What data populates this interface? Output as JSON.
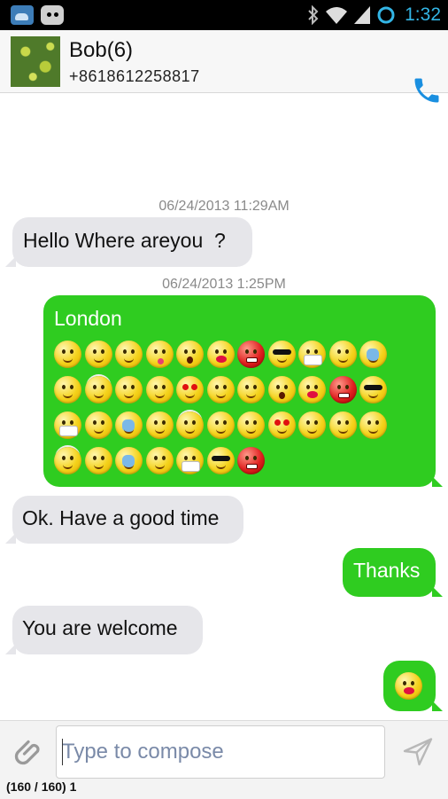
{
  "status_bar": {
    "time": "1:32",
    "icons": [
      "weather-notification-icon",
      "cyanogen-notification-icon",
      "bluetooth-icon",
      "wifi-icon",
      "signal-icon",
      "sync-icon"
    ],
    "time_color": "#33b5e5"
  },
  "header": {
    "contact_name": "Bob(6)",
    "contact_number": "+8618612258817",
    "call_icon": "phone-icon",
    "accent_color": "#1a8fe0"
  },
  "messages": [
    {
      "type": "timestamp",
      "text": "06/24/2013 11:29AM"
    },
    {
      "type": "incoming",
      "text": "Hello Where areyou  ?"
    },
    {
      "type": "timestamp",
      "text": "06/24/2013 1:25PM"
    },
    {
      "type": "outgoing",
      "text": "London",
      "emoji_count": 40
    },
    {
      "type": "incoming",
      "text": "Ok. Have a good time"
    },
    {
      "type": "outgoing",
      "text": "Thanks"
    },
    {
      "type": "incoming",
      "text": "You are welcome"
    },
    {
      "type": "outgoing",
      "emoji": "kiss-emoji"
    }
  ],
  "colors": {
    "outgoing_bubble": "#2fcc20",
    "incoming_bubble": "#e6e6ea"
  },
  "composer": {
    "placeholder": "Type to compose",
    "value": "",
    "char_counter": "(160 / 160) 1",
    "attach_icon": "paperclip-icon",
    "send_icon": "send-icon"
  }
}
